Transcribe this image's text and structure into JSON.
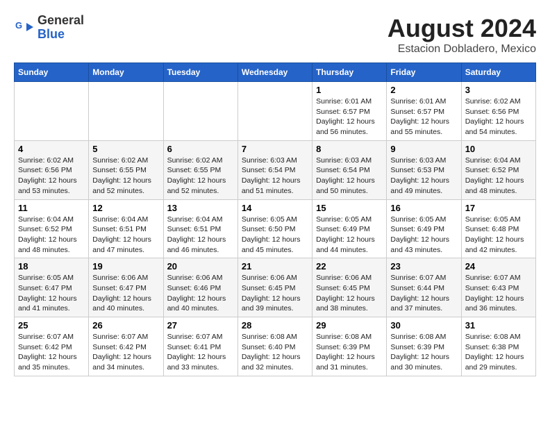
{
  "header": {
    "logo_line1": "General",
    "logo_line2": "Blue",
    "month_year": "August 2024",
    "location": "Estacion Dobladero, Mexico"
  },
  "weekdays": [
    "Sunday",
    "Monday",
    "Tuesday",
    "Wednesday",
    "Thursday",
    "Friday",
    "Saturday"
  ],
  "weeks": [
    [
      {
        "day": "",
        "info": ""
      },
      {
        "day": "",
        "info": ""
      },
      {
        "day": "",
        "info": ""
      },
      {
        "day": "",
        "info": ""
      },
      {
        "day": "1",
        "info": "Sunrise: 6:01 AM\nSunset: 6:57 PM\nDaylight: 12 hours\nand 56 minutes."
      },
      {
        "day": "2",
        "info": "Sunrise: 6:01 AM\nSunset: 6:57 PM\nDaylight: 12 hours\nand 55 minutes."
      },
      {
        "day": "3",
        "info": "Sunrise: 6:02 AM\nSunset: 6:56 PM\nDaylight: 12 hours\nand 54 minutes."
      }
    ],
    [
      {
        "day": "4",
        "info": "Sunrise: 6:02 AM\nSunset: 6:56 PM\nDaylight: 12 hours\nand 53 minutes."
      },
      {
        "day": "5",
        "info": "Sunrise: 6:02 AM\nSunset: 6:55 PM\nDaylight: 12 hours\nand 52 minutes."
      },
      {
        "day": "6",
        "info": "Sunrise: 6:02 AM\nSunset: 6:55 PM\nDaylight: 12 hours\nand 52 minutes."
      },
      {
        "day": "7",
        "info": "Sunrise: 6:03 AM\nSunset: 6:54 PM\nDaylight: 12 hours\nand 51 minutes."
      },
      {
        "day": "8",
        "info": "Sunrise: 6:03 AM\nSunset: 6:54 PM\nDaylight: 12 hours\nand 50 minutes."
      },
      {
        "day": "9",
        "info": "Sunrise: 6:03 AM\nSunset: 6:53 PM\nDaylight: 12 hours\nand 49 minutes."
      },
      {
        "day": "10",
        "info": "Sunrise: 6:04 AM\nSunset: 6:52 PM\nDaylight: 12 hours\nand 48 minutes."
      }
    ],
    [
      {
        "day": "11",
        "info": "Sunrise: 6:04 AM\nSunset: 6:52 PM\nDaylight: 12 hours\nand 48 minutes."
      },
      {
        "day": "12",
        "info": "Sunrise: 6:04 AM\nSunset: 6:51 PM\nDaylight: 12 hours\nand 47 minutes."
      },
      {
        "day": "13",
        "info": "Sunrise: 6:04 AM\nSunset: 6:51 PM\nDaylight: 12 hours\nand 46 minutes."
      },
      {
        "day": "14",
        "info": "Sunrise: 6:05 AM\nSunset: 6:50 PM\nDaylight: 12 hours\nand 45 minutes."
      },
      {
        "day": "15",
        "info": "Sunrise: 6:05 AM\nSunset: 6:49 PM\nDaylight: 12 hours\nand 44 minutes."
      },
      {
        "day": "16",
        "info": "Sunrise: 6:05 AM\nSunset: 6:49 PM\nDaylight: 12 hours\nand 43 minutes."
      },
      {
        "day": "17",
        "info": "Sunrise: 6:05 AM\nSunset: 6:48 PM\nDaylight: 12 hours\nand 42 minutes."
      }
    ],
    [
      {
        "day": "18",
        "info": "Sunrise: 6:05 AM\nSunset: 6:47 PM\nDaylight: 12 hours\nand 41 minutes."
      },
      {
        "day": "19",
        "info": "Sunrise: 6:06 AM\nSunset: 6:47 PM\nDaylight: 12 hours\nand 40 minutes."
      },
      {
        "day": "20",
        "info": "Sunrise: 6:06 AM\nSunset: 6:46 PM\nDaylight: 12 hours\nand 40 minutes."
      },
      {
        "day": "21",
        "info": "Sunrise: 6:06 AM\nSunset: 6:45 PM\nDaylight: 12 hours\nand 39 minutes."
      },
      {
        "day": "22",
        "info": "Sunrise: 6:06 AM\nSunset: 6:45 PM\nDaylight: 12 hours\nand 38 minutes."
      },
      {
        "day": "23",
        "info": "Sunrise: 6:07 AM\nSunset: 6:44 PM\nDaylight: 12 hours\nand 37 minutes."
      },
      {
        "day": "24",
        "info": "Sunrise: 6:07 AM\nSunset: 6:43 PM\nDaylight: 12 hours\nand 36 minutes."
      }
    ],
    [
      {
        "day": "25",
        "info": "Sunrise: 6:07 AM\nSunset: 6:42 PM\nDaylight: 12 hours\nand 35 minutes."
      },
      {
        "day": "26",
        "info": "Sunrise: 6:07 AM\nSunset: 6:42 PM\nDaylight: 12 hours\nand 34 minutes."
      },
      {
        "day": "27",
        "info": "Sunrise: 6:07 AM\nSunset: 6:41 PM\nDaylight: 12 hours\nand 33 minutes."
      },
      {
        "day": "28",
        "info": "Sunrise: 6:08 AM\nSunset: 6:40 PM\nDaylight: 12 hours\nand 32 minutes."
      },
      {
        "day": "29",
        "info": "Sunrise: 6:08 AM\nSunset: 6:39 PM\nDaylight: 12 hours\nand 31 minutes."
      },
      {
        "day": "30",
        "info": "Sunrise: 6:08 AM\nSunset: 6:39 PM\nDaylight: 12 hours\nand 30 minutes."
      },
      {
        "day": "31",
        "info": "Sunrise: 6:08 AM\nSunset: 6:38 PM\nDaylight: 12 hours\nand 29 minutes."
      }
    ]
  ]
}
